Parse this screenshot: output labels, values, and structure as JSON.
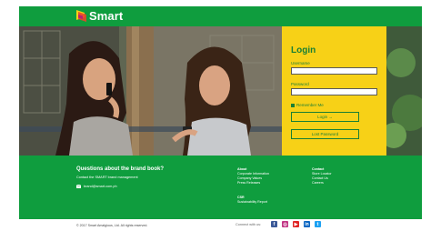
{
  "brand": {
    "name": "Smart"
  },
  "login": {
    "title": "Login",
    "username_label": "Username",
    "password_label": "Password",
    "remember_label": "Remember Me",
    "login_button": "Login →",
    "lost_password_button": "Lost Password"
  },
  "footer": {
    "question_title": "Questions about the brand book?",
    "question_sub": "Contact the SMART brand management",
    "email": "brand@smart.com.ph",
    "about": {
      "heading": "About",
      "items": [
        "Corporate Information",
        "Company Values",
        "Press Releases"
      ]
    },
    "csr": {
      "heading": "CSR",
      "items": [
        "Sustainability Report"
      ]
    },
    "contact": {
      "heading": "Contact",
      "items": [
        "Store Locator",
        "Contact Us",
        "Careers"
      ]
    }
  },
  "bottom": {
    "copyright": "© 2017 Smart Amalgious, Ltd. All rights reserved.",
    "connect_label": "Connect with us:",
    "socials": [
      {
        "icon": "facebook-icon",
        "glyph": "f",
        "color": "#3b5998"
      },
      {
        "icon": "instagram-icon",
        "glyph": "◎",
        "color": "#c13584"
      },
      {
        "icon": "youtube-icon",
        "glyph": "▶",
        "color": "#e02424"
      },
      {
        "icon": "linkedin-icon",
        "glyph": "in",
        "color": "#0a66c2"
      },
      {
        "icon": "twitter-icon",
        "glyph": "t",
        "color": "#1da1f2"
      }
    ]
  },
  "colors": {
    "brand_green": "#0f9d3e",
    "login_yellow": "#f7d117"
  }
}
